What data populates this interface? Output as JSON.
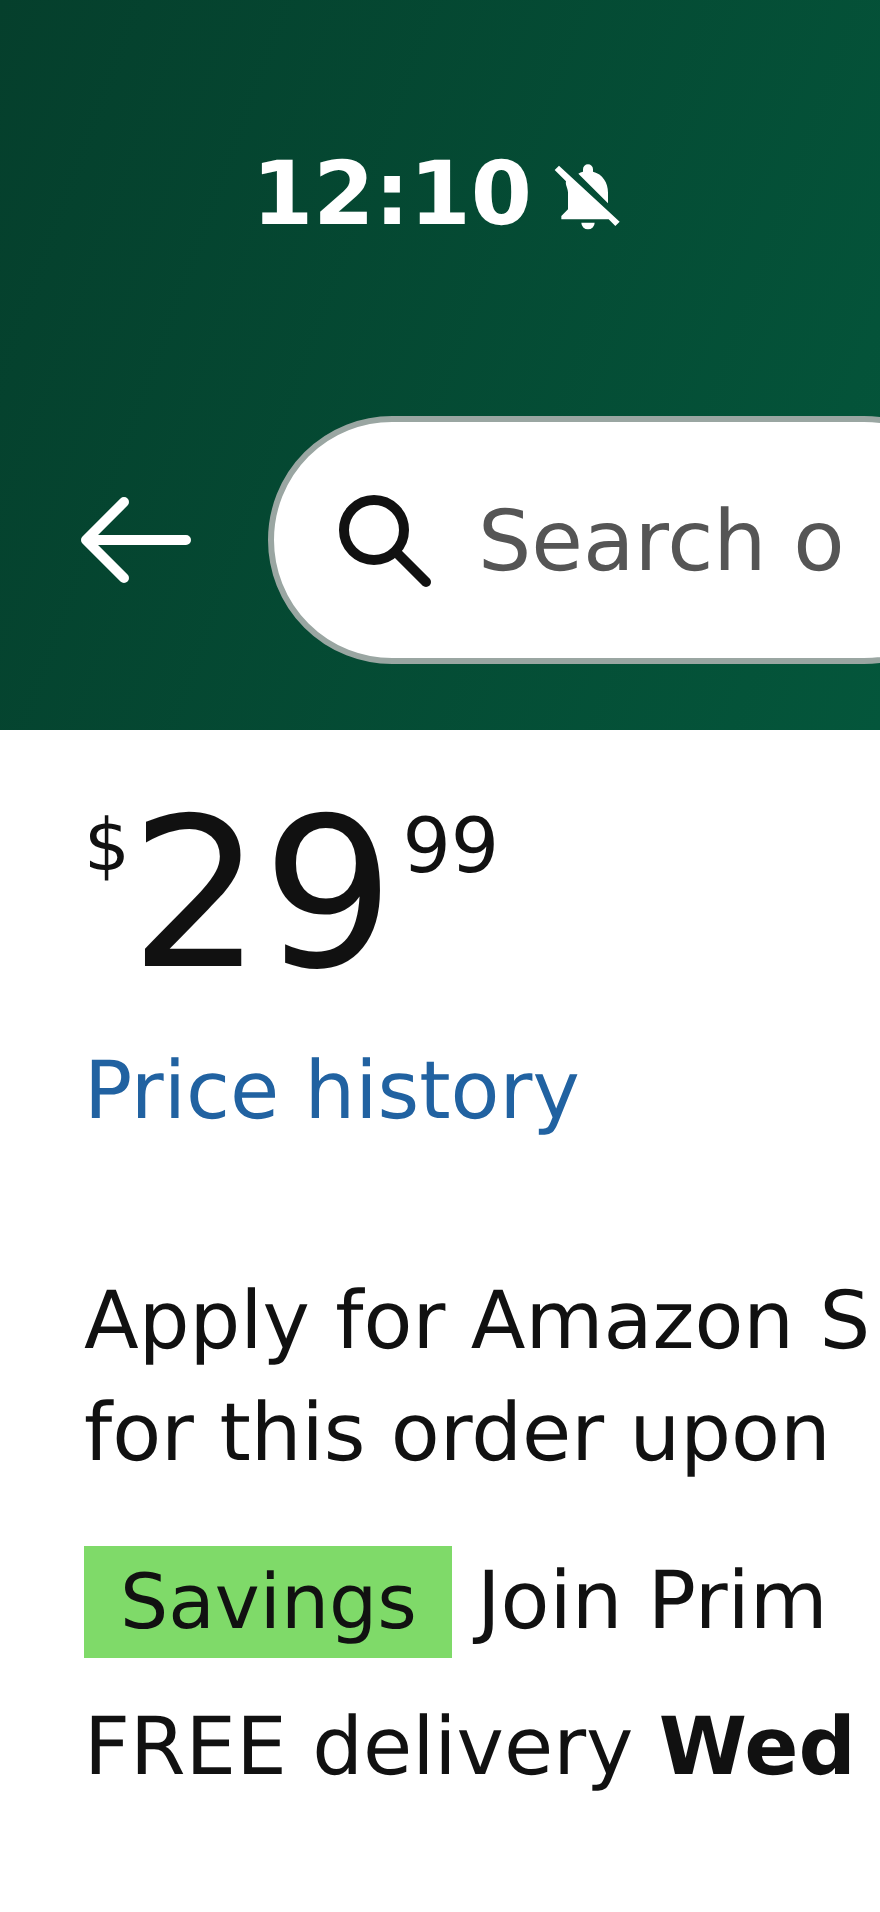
{
  "status_bar": {
    "time": "12:10",
    "muted": true
  },
  "search": {
    "placeholder": "Search o"
  },
  "price": {
    "currency": "$",
    "whole": "29",
    "fraction": "99"
  },
  "price_history_link": "Price history",
  "card_offer": [
    "Apply for Amazon S",
    "for this order upon"
  ],
  "savings": {
    "badge": "Savings",
    "text": "Join Prim"
  },
  "delivery": "FREE delivery **Wed**"
}
